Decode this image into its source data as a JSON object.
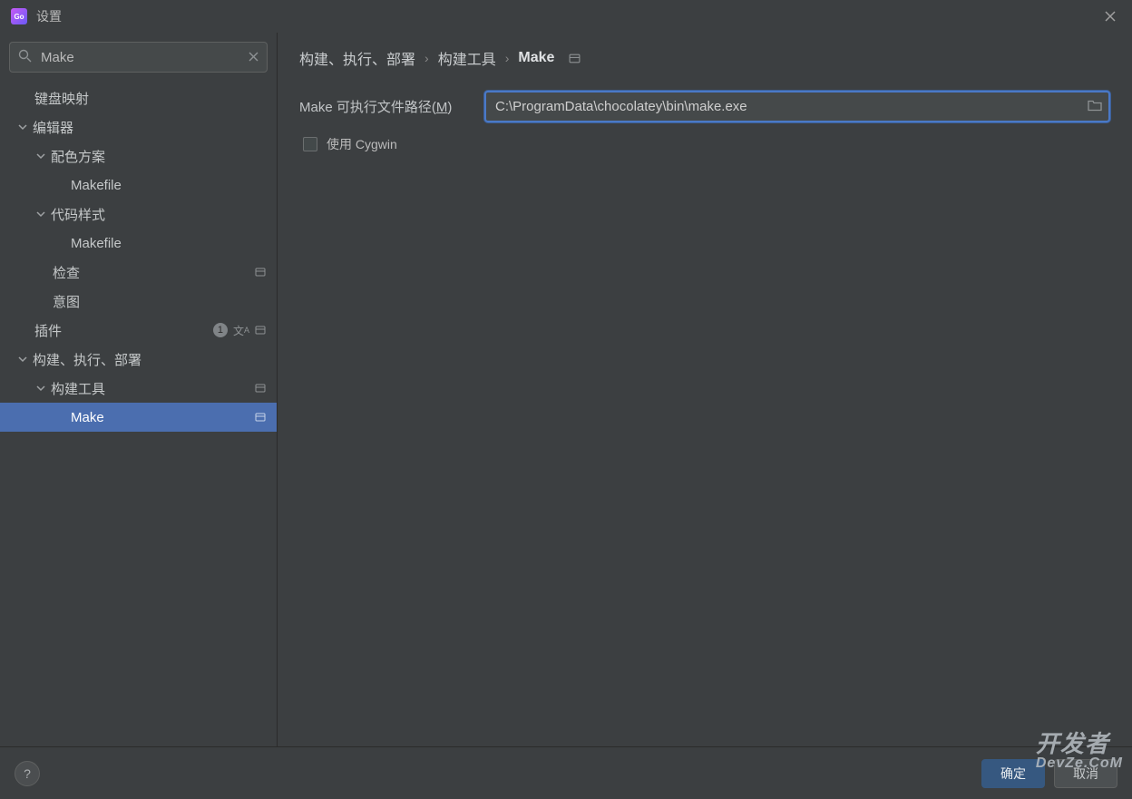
{
  "titlebar": {
    "title": "设置"
  },
  "search": {
    "value": "Make"
  },
  "tree": {
    "keyboard": "键盘映射",
    "editor": "编辑器",
    "colorscheme": "配色方案",
    "colorscheme_makefile": "Makefile",
    "codestyle": "代码样式",
    "codestyle_makefile": "Makefile",
    "inspect": "检查",
    "intent": "意图",
    "plugins": "插件",
    "plugins_badge": "1",
    "build": "构建、执行、部署",
    "buildtools": "构建工具",
    "make": "Make"
  },
  "breadcrumb": {
    "c1": "构建、执行、部署",
    "c2": "构建工具",
    "c3": "Make"
  },
  "form": {
    "path_label_pre": "Make 可执行文件路径(",
    "path_label_key": "M",
    "path_label_post": ")",
    "path_value": "C:\\ProgramData\\chocolatey\\bin\\make.exe",
    "cygwin": "使用 Cygwin"
  },
  "footer": {
    "ok": "确定",
    "cancel": "取消"
  },
  "watermark": {
    "line1": "开发者",
    "line2": "DevZe.CoM"
  }
}
